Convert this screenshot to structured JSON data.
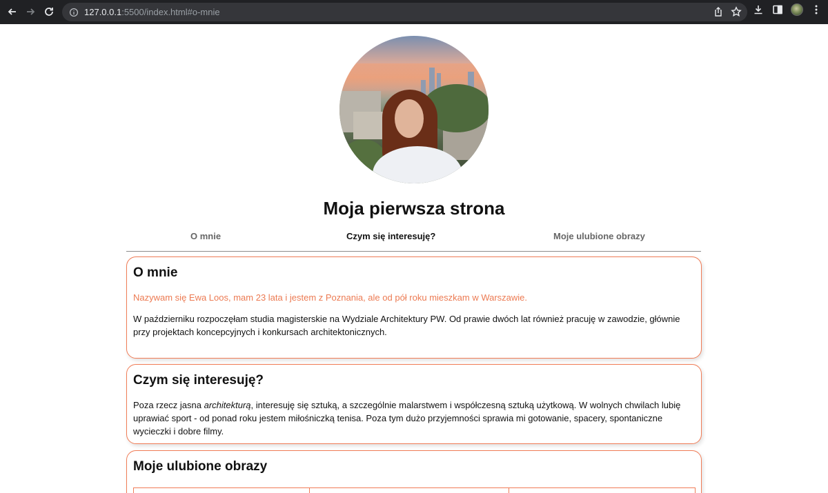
{
  "browser": {
    "url_host": "127.0.0.1",
    "url_rest": ":5500/index.html#o-mnie"
  },
  "site": {
    "title": "Moja pierwsza strona"
  },
  "nav": {
    "items": [
      {
        "label": "O mnie",
        "active": false
      },
      {
        "label": "Czym się interesuję?",
        "active": true
      },
      {
        "label": "Moje ulubione obrazy",
        "active": false
      }
    ]
  },
  "sections": {
    "about": {
      "heading": "O mnie",
      "intro": "Nazywam się Ewa Loos, mam 23 lata i jestem z Poznania, ale od pół roku mieszkam w Warszawie.",
      "body": "W październiku rozpoczęłam studia magisterskie na Wydziale Architektury PW. Od prawie dwóch lat również pracuję w zawodzie, głównie przy projektach koncepcyjnych i konkursach architektonicznych."
    },
    "interests": {
      "heading": "Czym się interesuję?",
      "body_before": "Poza rzecz jasna ",
      "body_em": "architekturą",
      "body_after": ", interesuję się sztuką, a szczególnie malarstwem i współczesną sztuką użytkową. W wolnych chwilach lubię uprawiać sport - od ponad roku jestem miłośniczką tenisa. Poza tym dużo przyjemności sprawia mi gotowanie, spacery, spontaniczne wycieczki i dobre filmy."
    },
    "paintings": {
      "heading": "Moje ulubione obrazy"
    }
  },
  "colors": {
    "accent": "#ec7a52",
    "chrome_bg": "#202124"
  }
}
